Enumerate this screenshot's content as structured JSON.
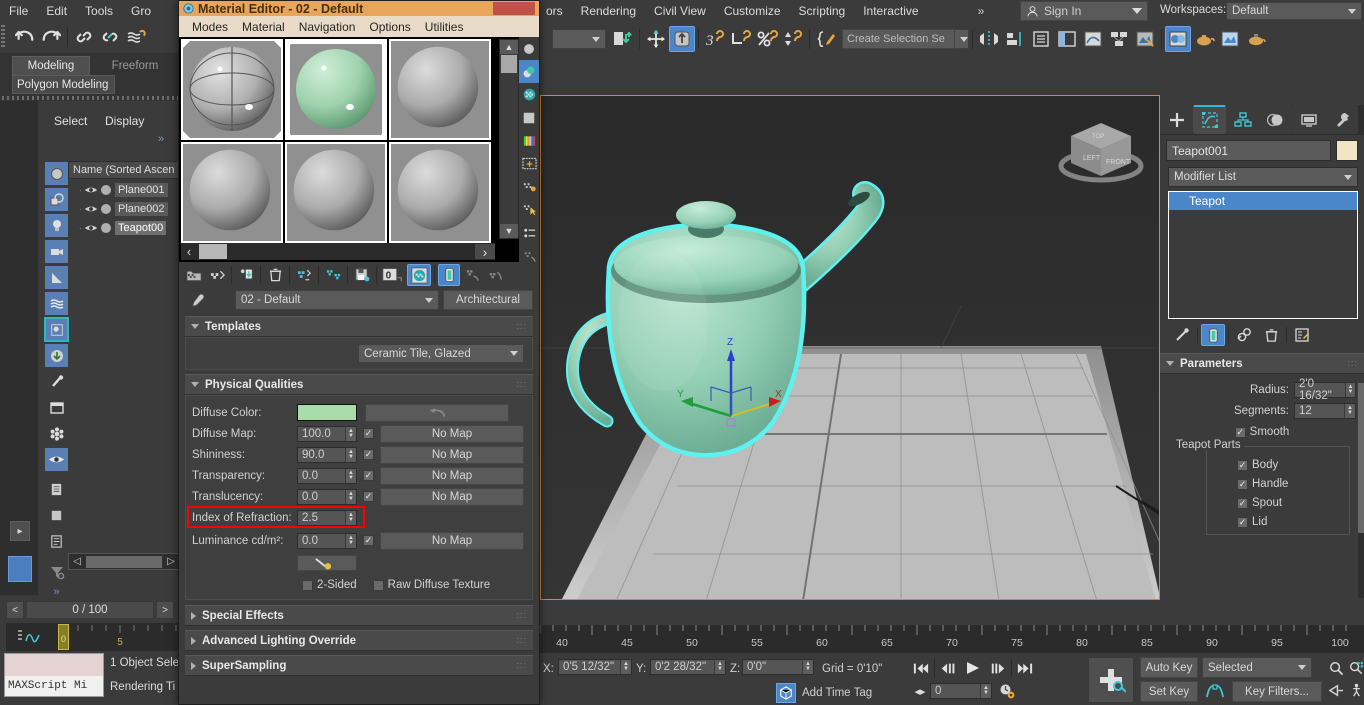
{
  "app": {
    "menus": [
      "File",
      "Edit",
      "Tools",
      "Gro"
    ],
    "menus_right": [
      "ors",
      "Rendering",
      "Civil View",
      "Customize",
      "Scripting",
      "Interactive"
    ],
    "overflow_label": "»",
    "sign_in": "Sign In",
    "workspaces_label": "Workspaces:",
    "workspace_value": "Default"
  },
  "ribbon": {
    "tabs": [
      "Modeling",
      "Freeform"
    ],
    "active_tab": "Modeling",
    "subtab": "Polygon Modeling"
  },
  "toolbar": {
    "create_selection_set_placeholder": "Create Selection Se"
  },
  "scene_explorer": {
    "menus": [
      "Select",
      "Display"
    ],
    "overflow": "»",
    "column_header": "Name (Sorted Ascen",
    "rows": [
      {
        "name": "Plane001",
        "selected": false
      },
      {
        "name": "Plane002",
        "selected": false
      },
      {
        "name": "Teapot00",
        "selected": true
      }
    ],
    "filter_icons": [
      "geometry-icon",
      "shapes-icon",
      "lights-icon",
      "cameras-icon",
      "helpers-icon",
      "spacewarps-icon",
      "groups-icon",
      "xrefs-icon",
      "bone-icon",
      "container-icon",
      "particle-icon",
      "visibility-icon",
      "layers-icon",
      "material-icon",
      "notes-icon",
      "filter-icon"
    ]
  },
  "material_editor": {
    "title": "Material Editor - 02 - Default",
    "menus": [
      "Modes",
      "Material",
      "Navigation",
      "Options",
      "Utilities"
    ],
    "slots": [
      {
        "id": "slot-1",
        "color": "#a8a8a8",
        "active": true,
        "wire": true
      },
      {
        "id": "slot-2",
        "color": "#9fd2ae",
        "active": true,
        "wire": false
      },
      {
        "id": "slot-3",
        "color": "#a8a8a8",
        "active": false,
        "wire": false
      },
      {
        "id": "slot-4",
        "color": "#a8a8a8",
        "active": false,
        "wire": false
      },
      {
        "id": "slot-5",
        "color": "#a8a8a8",
        "active": false,
        "wire": false
      },
      {
        "id": "slot-6",
        "color": "#a8a8a8",
        "active": false,
        "wire": false
      }
    ],
    "material_name": "02 - Default",
    "material_type_button": "Architectural",
    "templates": {
      "title": "Templates",
      "value": "Ceramic Tile, Glazed"
    },
    "physical_qualities": {
      "title": "Physical Qualities",
      "rows": [
        {
          "label": "Diffuse Color:",
          "value": "",
          "swatch": "#a8dba8",
          "map": "",
          "kind": "color",
          "check": false
        },
        {
          "label": "Diffuse Map:",
          "value": "100.0",
          "map": "No Map",
          "kind": "spin",
          "check": true
        },
        {
          "label": "Shininess:",
          "value": "90.0",
          "map": "No Map",
          "kind": "spin",
          "check": true
        },
        {
          "label": "Transparency:",
          "value": "0.0",
          "map": "No Map",
          "kind": "spin",
          "check": true
        },
        {
          "label": "Translucency:",
          "value": "0.0",
          "map": "No Map",
          "kind": "spin",
          "check": true
        },
        {
          "label": "Index of Refraction:",
          "value": "2.5",
          "map": "",
          "kind": "spin",
          "check": false,
          "highlight": true
        },
        {
          "label": "Luminance cd/m²:",
          "value": "0.0",
          "map": "No Map",
          "kind": "spin",
          "check": true
        }
      ],
      "two_sided_label": "2-Sided",
      "two_sided_checked": false,
      "raw_diffuse_label": "Raw Diffuse Texture",
      "raw_diffuse_checked": false
    },
    "rollouts": [
      "Special Effects",
      "Advanced Lighting Override",
      "SuperSampling"
    ],
    "nav_prev": "‹",
    "nav_next": "›"
  },
  "command_panel": {
    "tabs": [
      "create-tab",
      "modify-tab",
      "hierarchy-tab",
      "motion-tab",
      "display-tab",
      "utilities-tab"
    ],
    "active_tab_index": 1,
    "object_name": "Teapot001",
    "object_color": "#efe6c3",
    "modifier_list_label": "Modifier List",
    "stack": [
      {
        "label": "Teapot",
        "selected": true
      }
    ],
    "stack_tools": [
      "pin-stack-icon",
      "show-end-result-icon",
      "make-unique-icon",
      "remove-modifier-icon",
      "configure-sets-icon"
    ],
    "parameters": {
      "title": "Parameters",
      "radius_label": "Radius:",
      "radius_value": "2'0 16/32\"",
      "segments_label": "Segments:",
      "segments_value": "12",
      "smooth_label": "Smooth",
      "smooth_checked": true,
      "teapot_parts_label": "Teapot Parts",
      "parts": [
        {
          "label": "Body",
          "checked": true
        },
        {
          "label": "Handle",
          "checked": true
        },
        {
          "label": "Spout",
          "checked": true
        },
        {
          "label": "Lid",
          "checked": true
        }
      ]
    }
  },
  "viewport": {
    "teapot_color": "#8fcdb3",
    "selection_outline": "#5ff0f0",
    "gizmo_axes": [
      "Z",
      "Y",
      "X"
    ],
    "viewcube_faces": [
      "TOP",
      "LEFT",
      "FRONT"
    ]
  },
  "timeline": {
    "frame_readout": "0 / 100",
    "prev": "<",
    "next": ">",
    "current_frame_tick": "0",
    "ticks_left": [
      "0",
      "5"
    ],
    "ruler_labels": [
      "40",
      "45",
      "50",
      "55",
      "60",
      "65",
      "70",
      "75",
      "80",
      "85",
      "90",
      "95",
      "100"
    ]
  },
  "status_bar": {
    "maxscript_label": "MAXScript Mi",
    "selection_status": "1 Object Sele",
    "render_time_label": "Rendering Ti",
    "x_label": "X:",
    "x_value": "0'5 12/32\"",
    "y_label": "Y:",
    "y_value": "0'2 28/32\"",
    "z_label": "Z:",
    "z_value": "0'0\"",
    "grid_label": "Grid = 0'10\"",
    "add_time_tag": "Add Time Tag"
  },
  "anim_bar": {
    "auto_key": "Auto Key",
    "set_key": "Set Key",
    "selected_dd": "Selected",
    "key_filters": "Key Filters...",
    "frame_field": "0"
  },
  "colors": {
    "accent_orange": "#e8a55c",
    "highlight_red": "#ff0000",
    "selection_blue": "#4a86c8",
    "teal": "#32c8c8"
  }
}
